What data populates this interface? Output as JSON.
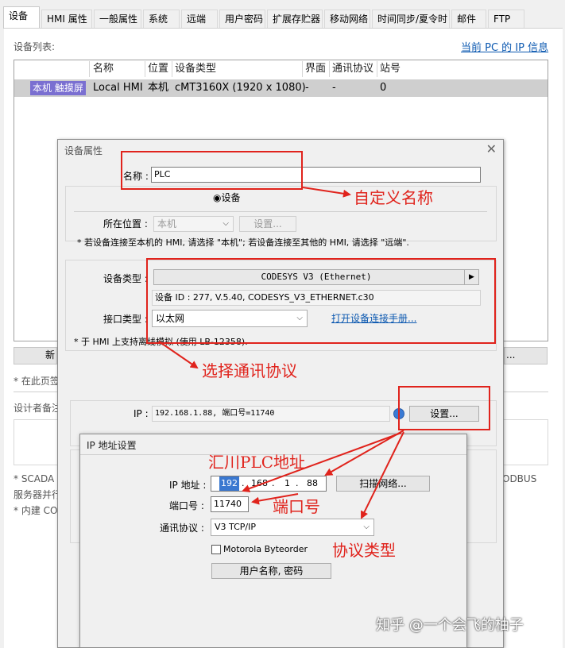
{
  "tabs": [
    "设备",
    "HMI 属性",
    "一般属性",
    "系统",
    "远端",
    "用户密码",
    "扩展存贮器",
    "移动网络",
    "时间同步/夏令时",
    "邮件",
    "FTP"
  ],
  "main": {
    "device_list_label": "设备列表:",
    "pc_ip_link": "当前 PC 的 IP 信息",
    "columns": [
      "名称",
      "位置",
      "设备类型",
      "界面",
      "通讯协议",
      "站号"
    ],
    "row": {
      "icon_label": "本机 触摸屏",
      "name": "Local HMI",
      "location": "本机",
      "device_type": "cMT3160X (1920 x 1080)",
      "interface": "-",
      "protocol": "-",
      "station": "0"
    },
    "hidden_fragments": {
      "new_btn": "新",
      "ellipsis_btn": "...",
      "note1": "* 在此页签",
      "designer_note": "设计者备注",
      "scada": "* SCADA",
      "server": "服务器并行",
      "builtin": "* 内建 CO",
      "modbus": "ODBUS"
    }
  },
  "device_dialog": {
    "title": "设备属性",
    "name_label": "名称 :",
    "name_value": "PLC",
    "radio_label": "设备",
    "location_label": "所在位置 :",
    "location_value": "本机",
    "settings_btn_disabled": "设置...",
    "location_hint": "* 若设备连接至本机的 HMI, 请选择 \"本机\"; 若设备连接至其他的 HMI, 请选择 \"远端\".",
    "device_type_label": "设备类型 :",
    "device_type_value": "CODESYS V3 (Ethernet)",
    "device_id": "设备 ID : 277, V.5.40, CODESYS_V3_ETHERNET.c30",
    "interface_label": "接口类型 :",
    "interface_value": "以太网",
    "manual_link": "打开设备连接手册...",
    "sim_hint": "* 于 HMI 上支持离线模拟 (使用 LB-12358).",
    "ip_label": "IP :",
    "ip_value": "192.168.1.88, 端口号=11740",
    "settings_btn": "设置..."
  },
  "ip_dialog": {
    "title": "IP 地址设置",
    "ip_label": "IP 地址 :",
    "ip_octets": [
      "192",
      "168",
      "1",
      "88"
    ],
    "scan_btn": "扫描网络...",
    "port_label": "端口号 :",
    "port_value": "11740",
    "protocol_label": "通讯协议 :",
    "protocol_value": "V3 TCP/IP",
    "byteorder_label": "Motorola Byteorder",
    "userpass_btn": "用户名称, 密码"
  },
  "annotations": {
    "custom_name": "自定义名称",
    "select_protocol": "选择通讯协议",
    "plc_address": "汇川PLC地址",
    "port": "端口号",
    "protocol_type": "协议类型",
    "annotation_color": "#e0231c"
  },
  "watermark": "知乎 @一个会飞的柚子"
}
